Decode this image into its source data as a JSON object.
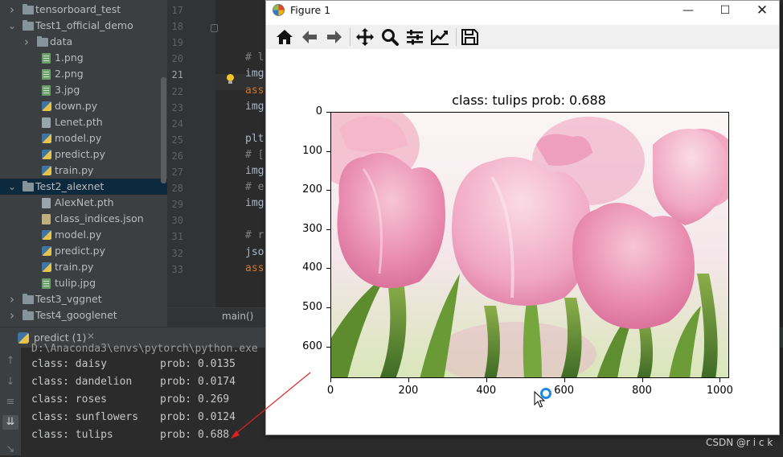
{
  "project_tree": {
    "rows": [
      {
        "label": "tensorboard_test",
        "type": "folder",
        "expanded": false
      },
      {
        "label": "Test1_official_demo",
        "type": "folder",
        "expanded": true
      },
      {
        "label": "data",
        "type": "folder",
        "expanded": false
      },
      {
        "label": "1.png",
        "type": "image"
      },
      {
        "label": "2.png",
        "type": "image"
      },
      {
        "label": "3.jpg",
        "type": "image"
      },
      {
        "label": "down.py",
        "type": "python"
      },
      {
        "label": "Lenet.pth",
        "type": "file"
      },
      {
        "label": "model.py",
        "type": "python"
      },
      {
        "label": "predict.py",
        "type": "python"
      },
      {
        "label": "train.py",
        "type": "python"
      },
      {
        "label": "Test2_alexnet",
        "type": "folder",
        "expanded": true,
        "selected": true
      },
      {
        "label": "AlexNet.pth",
        "type": "file"
      },
      {
        "label": "class_indices.json",
        "type": "json"
      },
      {
        "label": "model.py",
        "type": "python"
      },
      {
        "label": "predict.py",
        "type": "python"
      },
      {
        "label": "train.py",
        "type": "python"
      },
      {
        "label": "tulip.jpg",
        "type": "image"
      },
      {
        "label": "Test3_vggnet",
        "type": "folder",
        "expanded": false
      },
      {
        "label": "Test4_googlenet",
        "type": "folder",
        "expanded": false
      }
    ]
  },
  "editor": {
    "line_numbers": [
      "17",
      "18",
      "19",
      "20",
      "21",
      "22",
      "23",
      "24",
      "25",
      "26",
      "27",
      "28",
      "29",
      "30",
      "31",
      "32",
      "33"
    ],
    "current_line": "21",
    "code_lines": [
      {
        "line": "20",
        "text": "# l",
        "style": "comment"
      },
      {
        "line": "21",
        "text": "img",
        "style": "text"
      },
      {
        "line": "22",
        "text": "ass",
        "style": "keyword"
      },
      {
        "line": "23",
        "text": "img",
        "style": "text"
      },
      {
        "line": "25",
        "text": "plt",
        "style": "text"
      },
      {
        "line": "26",
        "text": "# [",
        "style": "comment"
      },
      {
        "line": "27",
        "text": "img",
        "style": "text"
      },
      {
        "line": "28",
        "text": "# e",
        "style": "comment"
      },
      {
        "line": "29",
        "text": "img",
        "style": "text"
      },
      {
        "line": "31",
        "text": "# r",
        "style": "comment"
      },
      {
        "line": "32",
        "text": "jso",
        "style": "text"
      },
      {
        "line": "33",
        "text": "ass",
        "style": "keyword"
      }
    ],
    "breadcrumb": "main()"
  },
  "run_panel": {
    "tab_label": "predict (1)",
    "console_path_fragment": "D:\\Anaconda3\\envs\\pytorch\\python.exe",
    "results": [
      {
        "cls": "class: daisy",
        "prob": "prob: 0.0135"
      },
      {
        "cls": "class: dandelion",
        "prob": "prob: 0.0174"
      },
      {
        "cls": "class: roses",
        "prob": "prob: 0.269"
      },
      {
        "cls": "class: sunflowers",
        "prob": "prob: 0.0124"
      },
      {
        "cls": "class: tulips",
        "prob": "prob: 0.688"
      }
    ]
  },
  "figure": {
    "window_title": "Figure 1",
    "toolbar": [
      "home-icon",
      "back-icon",
      "forward-icon",
      "pan-icon",
      "zoom-icon",
      "subplots-icon",
      "edit-curves-icon",
      "save-icon"
    ],
    "chart_data": {
      "type": "image",
      "title": "class: tulips   prob: 0.688",
      "xticks": [
        "0",
        "200",
        "400",
        "600",
        "800",
        "1000"
      ],
      "yticks": [
        "0",
        "100",
        "200",
        "300",
        "400",
        "500",
        "600"
      ],
      "xlim": [
        0,
        1024
      ],
      "ylim": [
        681,
        0
      ]
    }
  },
  "watermark": "CSDN @r i c k",
  "colors": {
    "ide_bg": "#2b2b2b",
    "tree_bg": "#3c3f41",
    "selection": "#0d293e",
    "annotation_arrow": "#e02020"
  }
}
